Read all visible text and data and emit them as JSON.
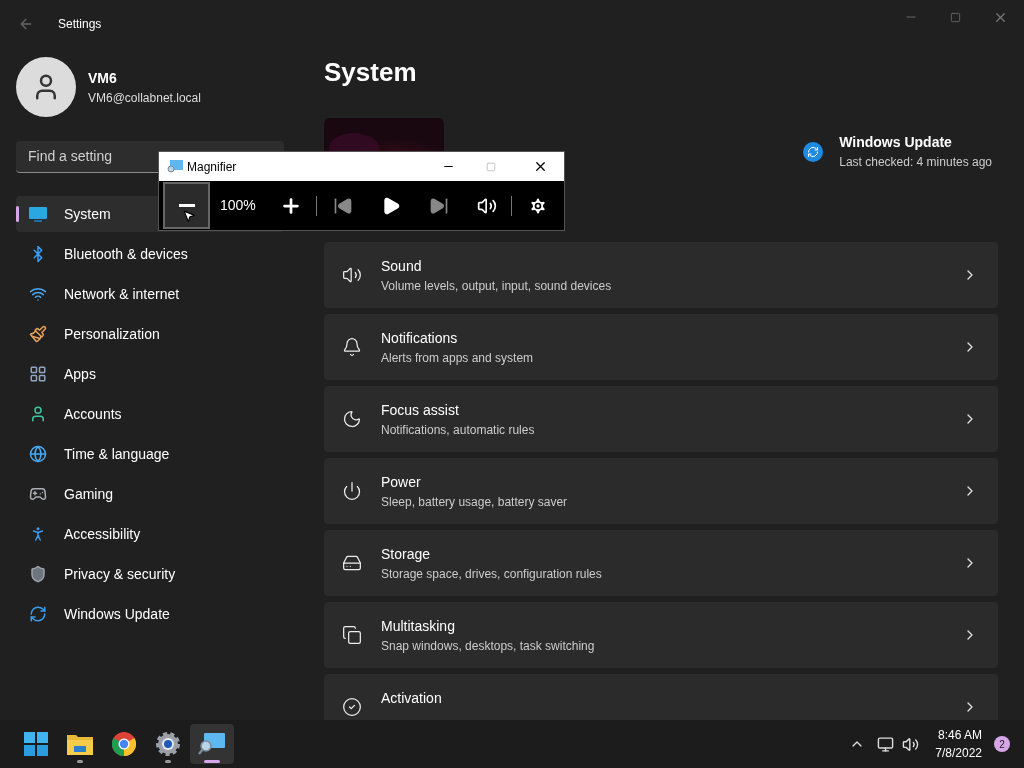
{
  "window": {
    "title": "Settings"
  },
  "user": {
    "name": "VM6",
    "email": "VM6@collabnet.local"
  },
  "search": {
    "placeholder": "Find a setting"
  },
  "sidebar": {
    "items": [
      {
        "label": "System",
        "selected": true
      },
      {
        "label": "Bluetooth & devices",
        "selected": false
      },
      {
        "label": "Network & internet",
        "selected": false
      },
      {
        "label": "Personalization",
        "selected": false
      },
      {
        "label": "Apps",
        "selected": false
      },
      {
        "label": "Accounts",
        "selected": false
      },
      {
        "label": "Time & language",
        "selected": false
      },
      {
        "label": "Gaming",
        "selected": false
      },
      {
        "label": "Accessibility",
        "selected": false
      },
      {
        "label": "Privacy & security",
        "selected": false
      },
      {
        "label": "Windows Update",
        "selected": false
      }
    ]
  },
  "page": {
    "title": "System",
    "update": {
      "title": "Windows Update",
      "status": "Last checked: 4 minutes ago"
    },
    "cards": [
      {
        "title": "Sound",
        "subtitle": "Volume levels, output, input, sound devices"
      },
      {
        "title": "Notifications",
        "subtitle": "Alerts from apps and system"
      },
      {
        "title": "Focus assist",
        "subtitle": "Notifications, automatic rules"
      },
      {
        "title": "Power",
        "subtitle": "Sleep, battery usage, battery saver"
      },
      {
        "title": "Storage",
        "subtitle": "Storage space, drives, configuration rules"
      },
      {
        "title": "Multitasking",
        "subtitle": "Snap windows, desktops, task switching"
      },
      {
        "title": "Activation"
      }
    ]
  },
  "magnifier": {
    "title": "Magnifier",
    "zoom": "100%"
  },
  "taskbar": {
    "apps": [
      {
        "running": false,
        "selected": false
      },
      {
        "running": true,
        "selected": false
      },
      {
        "running": false,
        "selected": false
      },
      {
        "running": true,
        "selected": false
      },
      {
        "running": true,
        "selected": true
      }
    ],
    "time": "8:46 AM",
    "date": "7/8/2022",
    "notifications": "2"
  }
}
